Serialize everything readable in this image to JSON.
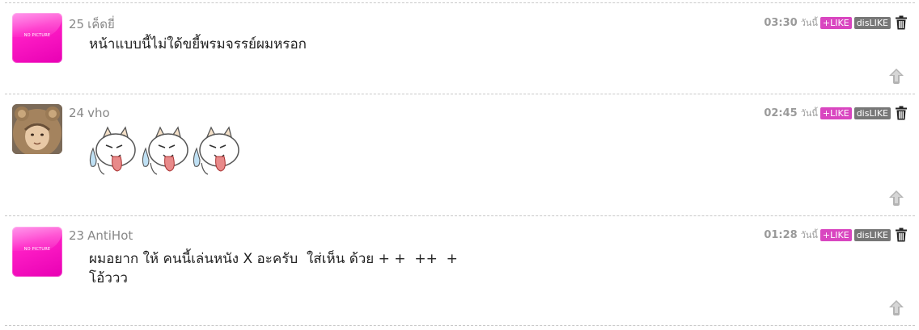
{
  "comments": [
    {
      "number": "25",
      "user": "เค็ดยี่",
      "avatar": "no-picture",
      "avatar_text": "NO PICTURE",
      "time": "03:30",
      "day": "วันนี้",
      "like_label": "+LIKE",
      "dislike_label": "disLIKE",
      "text": "หน้าแบบนี้ไม่ใด้ขยี้พรมจรรย์ผมหรอก"
    },
    {
      "number": "24",
      "user": "vho",
      "avatar": "photo",
      "time": "02:45",
      "day": "วันนี้",
      "like_label": "+LIKE",
      "dislike_label": "disLIKE",
      "text": "",
      "stickers": [
        "cat-tongue-emoticon",
        "cat-tongue-emoticon",
        "cat-tongue-emoticon"
      ]
    },
    {
      "number": "23",
      "user": "AntiHot",
      "avatar": "no-picture",
      "avatar_text": "NO PICTURE",
      "time": "01:28",
      "day": "วันนี้",
      "like_label": "+LIKE",
      "dislike_label": "disLIKE",
      "text_line1": "ผมอยาก ให้ คนนี้เล่นหนัง X อะครับ  ใส่เห็น ด้วย + +  ++  +",
      "text_line2": "โอ้ววว"
    }
  ],
  "colors": {
    "like": "#d946c0",
    "dislike": "#777777",
    "no_picture": "#ff1fc6",
    "separator": "#c8c8c8"
  },
  "icons": {
    "delete": "trash-icon",
    "reply": "reply-arrow-icon"
  }
}
